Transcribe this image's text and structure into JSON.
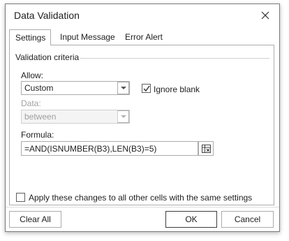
{
  "dialog": {
    "title": "Data Validation"
  },
  "tabs": [
    {
      "label": "Settings",
      "active": true
    },
    {
      "label": "Input Message",
      "active": false
    },
    {
      "label": "Error Alert",
      "active": false
    }
  ],
  "settings": {
    "group_label": "Validation criteria",
    "allow": {
      "label": "Allow:",
      "value": "Custom"
    },
    "ignore_blank": {
      "label": "Ignore blank",
      "checked": true
    },
    "data": {
      "label": "Data:",
      "value": "between",
      "disabled": true
    },
    "formula": {
      "label": "Formula:",
      "value": "=AND(ISNUMBER(B3),LEN(B3)=5)"
    },
    "apply_all": {
      "label": "Apply these changes to all other cells with the same settings",
      "checked": false
    }
  },
  "footer": {
    "clear_all": "Clear All",
    "ok": "OK",
    "cancel": "Cancel"
  },
  "colors": {
    "border": "#ababab",
    "disabled_text": "#a0a0a0"
  }
}
